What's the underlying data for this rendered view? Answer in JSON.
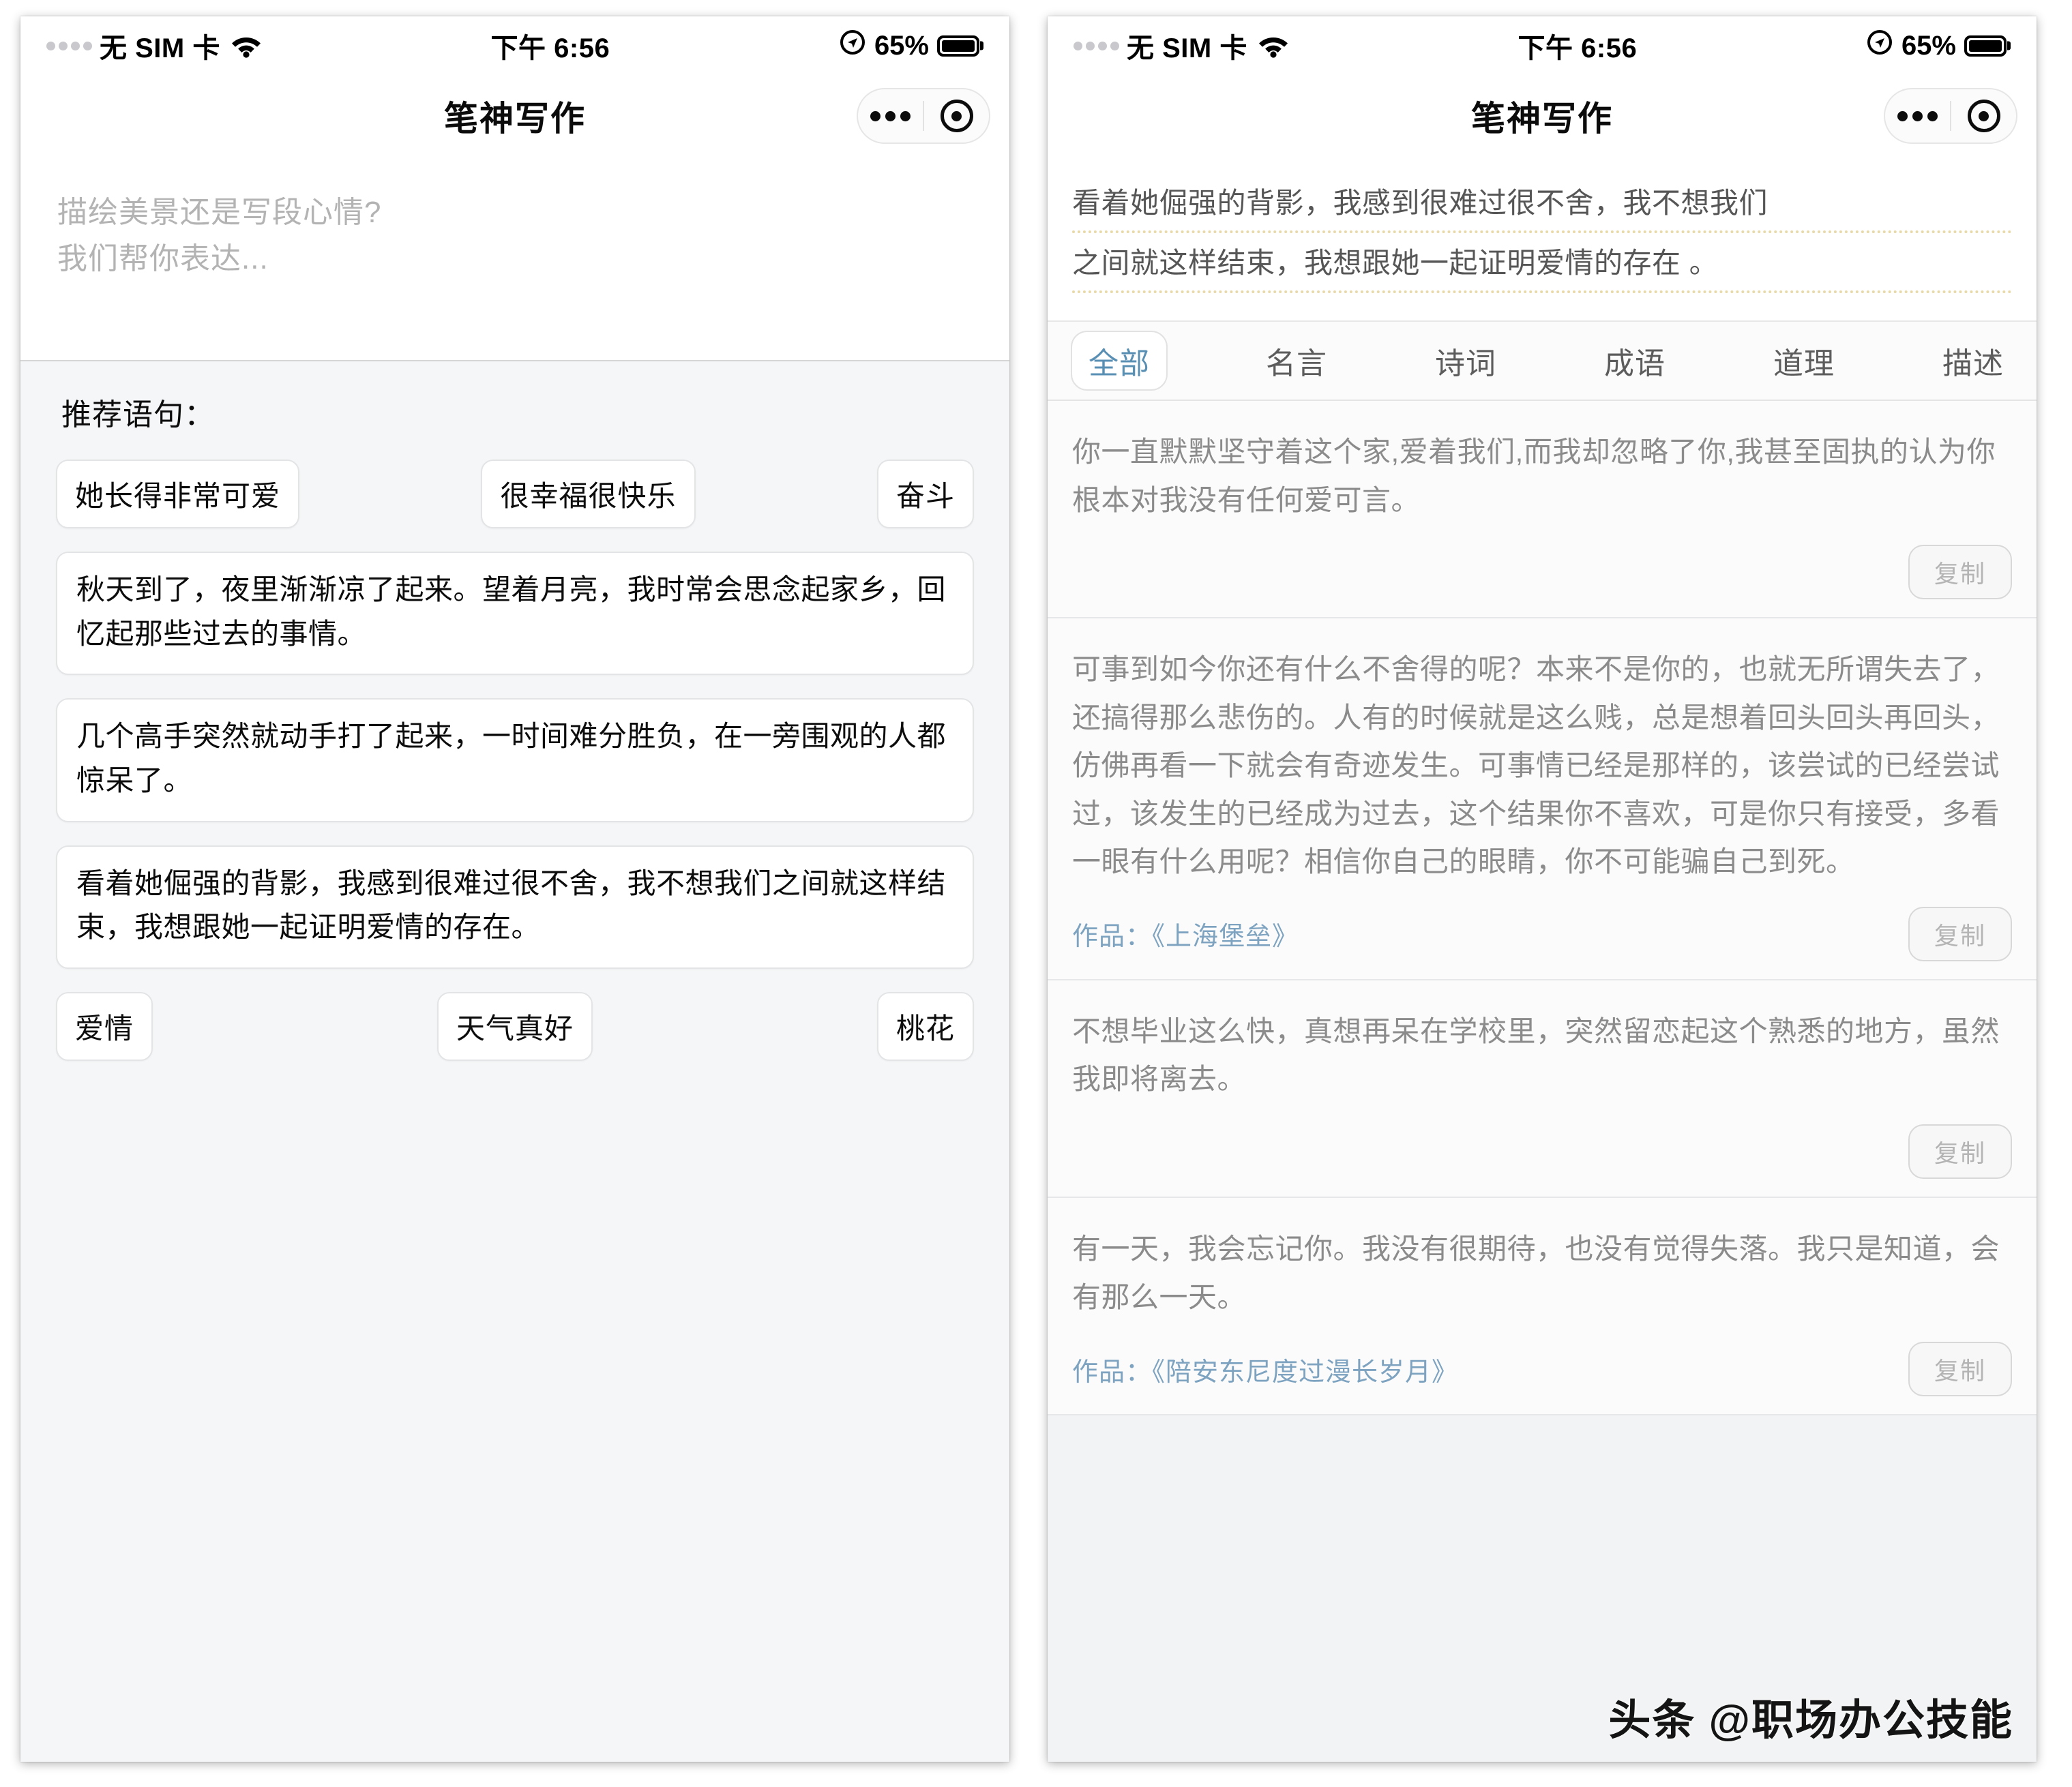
{
  "status_bar": {
    "carrier": "无 SIM 卡",
    "wifi_icon": "wifi-icon",
    "time": "下午 6:56",
    "location_icon": "location-icon",
    "battery_percent": "65%",
    "battery_icon": "battery-icon"
  },
  "navbar": {
    "title": "笔神写作",
    "more_icon": "more-dots-icon",
    "close_icon": "target-circle-icon"
  },
  "left_screen": {
    "compose": {
      "placeholder_line1": "描绘美景还是写段心情?",
      "placeholder_line2": "我们帮你表达...",
      "value": ""
    },
    "recommend_label": "推荐语句：",
    "chip_row_1": [
      "她长得非常可爱",
      "很幸福很快乐",
      "奋斗"
    ],
    "sentences": [
      "秋天到了，夜里渐渐凉了起来。望着月亮，我时常会思念起家乡，回忆起那些过去的事情。",
      "几个高手突然就动手打了起来，一时间难分胜负，在一旁围观的人都惊呆了。",
      "看着她倔强的背影，我感到很难过很不舍，我不想我们之间就这样结束，我想跟她一起证明爱情的存在。"
    ],
    "chip_row_2": [
      "爱情",
      "天气真好",
      "桃花"
    ]
  },
  "right_screen": {
    "input_line1": "看着她倔强的背影，我感到很难过很不舍，我不想我们",
    "input_line2": "之间就这样结束，我想跟她一起证明爱情的存在 。",
    "tabs": [
      {
        "label": "全部",
        "active": true
      },
      {
        "label": "名言",
        "active": false
      },
      {
        "label": "诗词",
        "active": false
      },
      {
        "label": "成语",
        "active": false
      },
      {
        "label": "道理",
        "active": false
      },
      {
        "label": "描述",
        "active": false
      }
    ],
    "copy_label": "复制",
    "cards": [
      {
        "text": "你一直默默坚守着这个家,爱着我们,而我却忽略了你,我甚至固执的认为你根本对我没有任何爱可言。",
        "source": ""
      },
      {
        "text": "可事到如今你还有什么不舍得的呢？本来不是你的，也就无所谓失去了，还搞得那么悲伤的。人有的时候就是这么贱，总是想着回头回头再回头，仿佛再看一下就会有奇迹发生。可事情已经是那样的，该尝试的已经尝试过，该发生的已经成为过去，这个结果你不喜欢，可是你只有接受，多看一眼有什么用呢？相信你自己的眼睛，你不可能骗自己到死。",
        "source": "作品：《上海堡垒》"
      },
      {
        "text": "不想毕业这么快，真想再呆在学校里，突然留恋起这个熟悉的地方，虽然我即将离去。",
        "source": ""
      },
      {
        "text": "有一天，我会忘记你。我没有很期待，也没有觉得失落。我只是知道，会有那么一天。",
        "source": "作品：《陪安东尼度过漫长岁月》"
      }
    ]
  },
  "watermark": "头条 @职场办公技能",
  "colors": {
    "accent_tab": "#5a8fb4",
    "source_link": "#7da3c0",
    "underline_dotted": "#e8d9a8",
    "card_text": "#8b8b8b",
    "page_bg": "#f2f3f4"
  }
}
